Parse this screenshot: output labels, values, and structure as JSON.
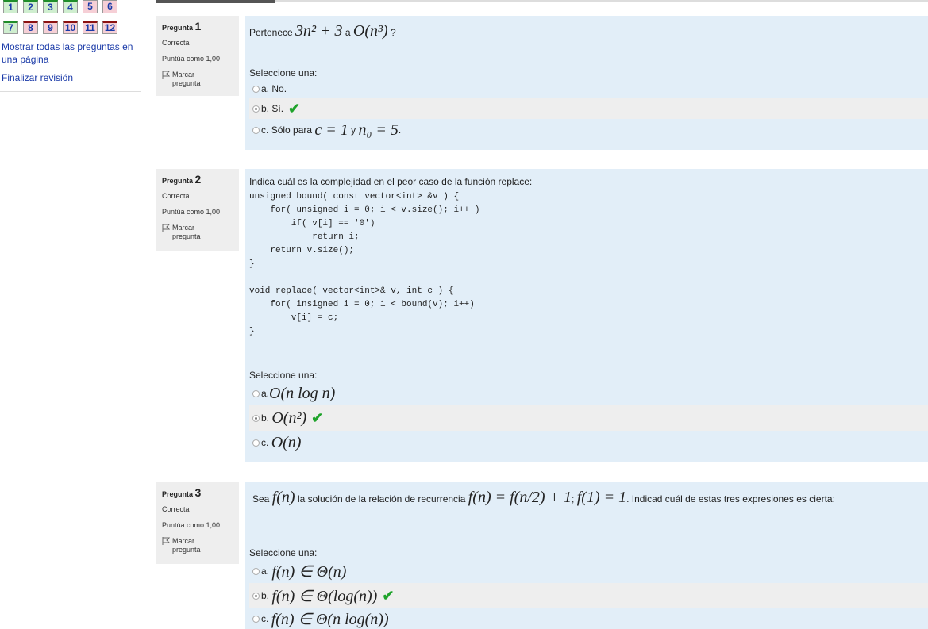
{
  "nav": {
    "buttons": [
      {
        "label": "1",
        "state": "correct"
      },
      {
        "label": "2",
        "state": "correct"
      },
      {
        "label": "3",
        "state": "correct"
      },
      {
        "label": "4",
        "state": "correct"
      },
      {
        "label": "5",
        "state": "plain"
      },
      {
        "label": "6",
        "state": "plain"
      },
      {
        "label": "7",
        "state": "correct"
      },
      {
        "label": "8",
        "state": "wrong"
      },
      {
        "label": "9",
        "state": "wrong"
      },
      {
        "label": "10",
        "state": "wrong"
      },
      {
        "label": "11",
        "state": "wrong"
      },
      {
        "label": "12",
        "state": "wrong"
      }
    ],
    "show_all": "Mostrar todas las preguntas en una página",
    "finish": "Finalizar revisión"
  },
  "questions": [
    {
      "label": "Pregunta",
      "number": "1",
      "status": "Correcta",
      "grade": "Puntúa como 1,00",
      "flag": "Marcar pregunta",
      "text_pre": "Pertenece",
      "text_mid": "a",
      "text_post": "?",
      "expr1": "3n² + 3",
      "expr2": "O(n³)",
      "select_prompt": "Seleccione una:",
      "options": [
        {
          "letter": "a.",
          "text": "No."
        },
        {
          "letter": "b.",
          "text": "Sí."
        },
        {
          "letter": "c.",
          "text": "Sólo para",
          "m1": "c = 1",
          "mid": "y",
          "m2": "n₀ = 5",
          "post": "."
        }
      ]
    },
    {
      "label": "Pregunta",
      "number": "2",
      "status": "Correcta",
      "grade": "Puntúa como 1,00",
      "flag": "Marcar pregunta",
      "text": "Indica cuál es la complejidad en el peor caso de la función replace:",
      "code": "unsigned bound( const vector<int> &v ) {\n    for( unsigned i = 0; i < v.size(); i++ )\n        if( v[i] == '0')\n            return i;\n    return v.size();\n}\n\nvoid replace( vector<int>& v, int c ) {\n    for( insigned i = 0; i < bound(v); i++)\n        v[i] = c;\n}",
      "select_prompt": "Seleccione una:",
      "options": [
        {
          "letter": "a.",
          "math": "O(n log n)"
        },
        {
          "letter": "b.",
          "math": "O(n²)"
        },
        {
          "letter": "c.",
          "math": "O(n)"
        }
      ]
    },
    {
      "label": "Pregunta",
      "number": "3",
      "status": "Correcta",
      "grade": "Puntúa como 1,00",
      "flag": "Marcar pregunta",
      "text_pre": "Sea",
      "m1": "f(n)",
      "text_mid": "la solución de la relación de recurrencia",
      "m2": "f(n) = f(n/2) + 1",
      "sep": ";",
      "m3": "f(1) = 1",
      "text_post": ". Indicad cuál de estas tres expresiones es cierta:",
      "select_prompt": "Seleccione una:",
      "options": [
        {
          "letter": "a.",
          "math": "f(n) ∈ Θ(n)"
        },
        {
          "letter": "b.",
          "math": "f(n) ∈ Θ(log(n))"
        },
        {
          "letter": "c.",
          "math": "f(n) ∈ Θ(n log(n))"
        }
      ]
    }
  ],
  "checkmark": "✔",
  "colors": {
    "content_bg": "#e2eef8",
    "info_bg": "#eeeeee",
    "correct_green": "#1fa32b",
    "link": "#1a3aa8"
  }
}
